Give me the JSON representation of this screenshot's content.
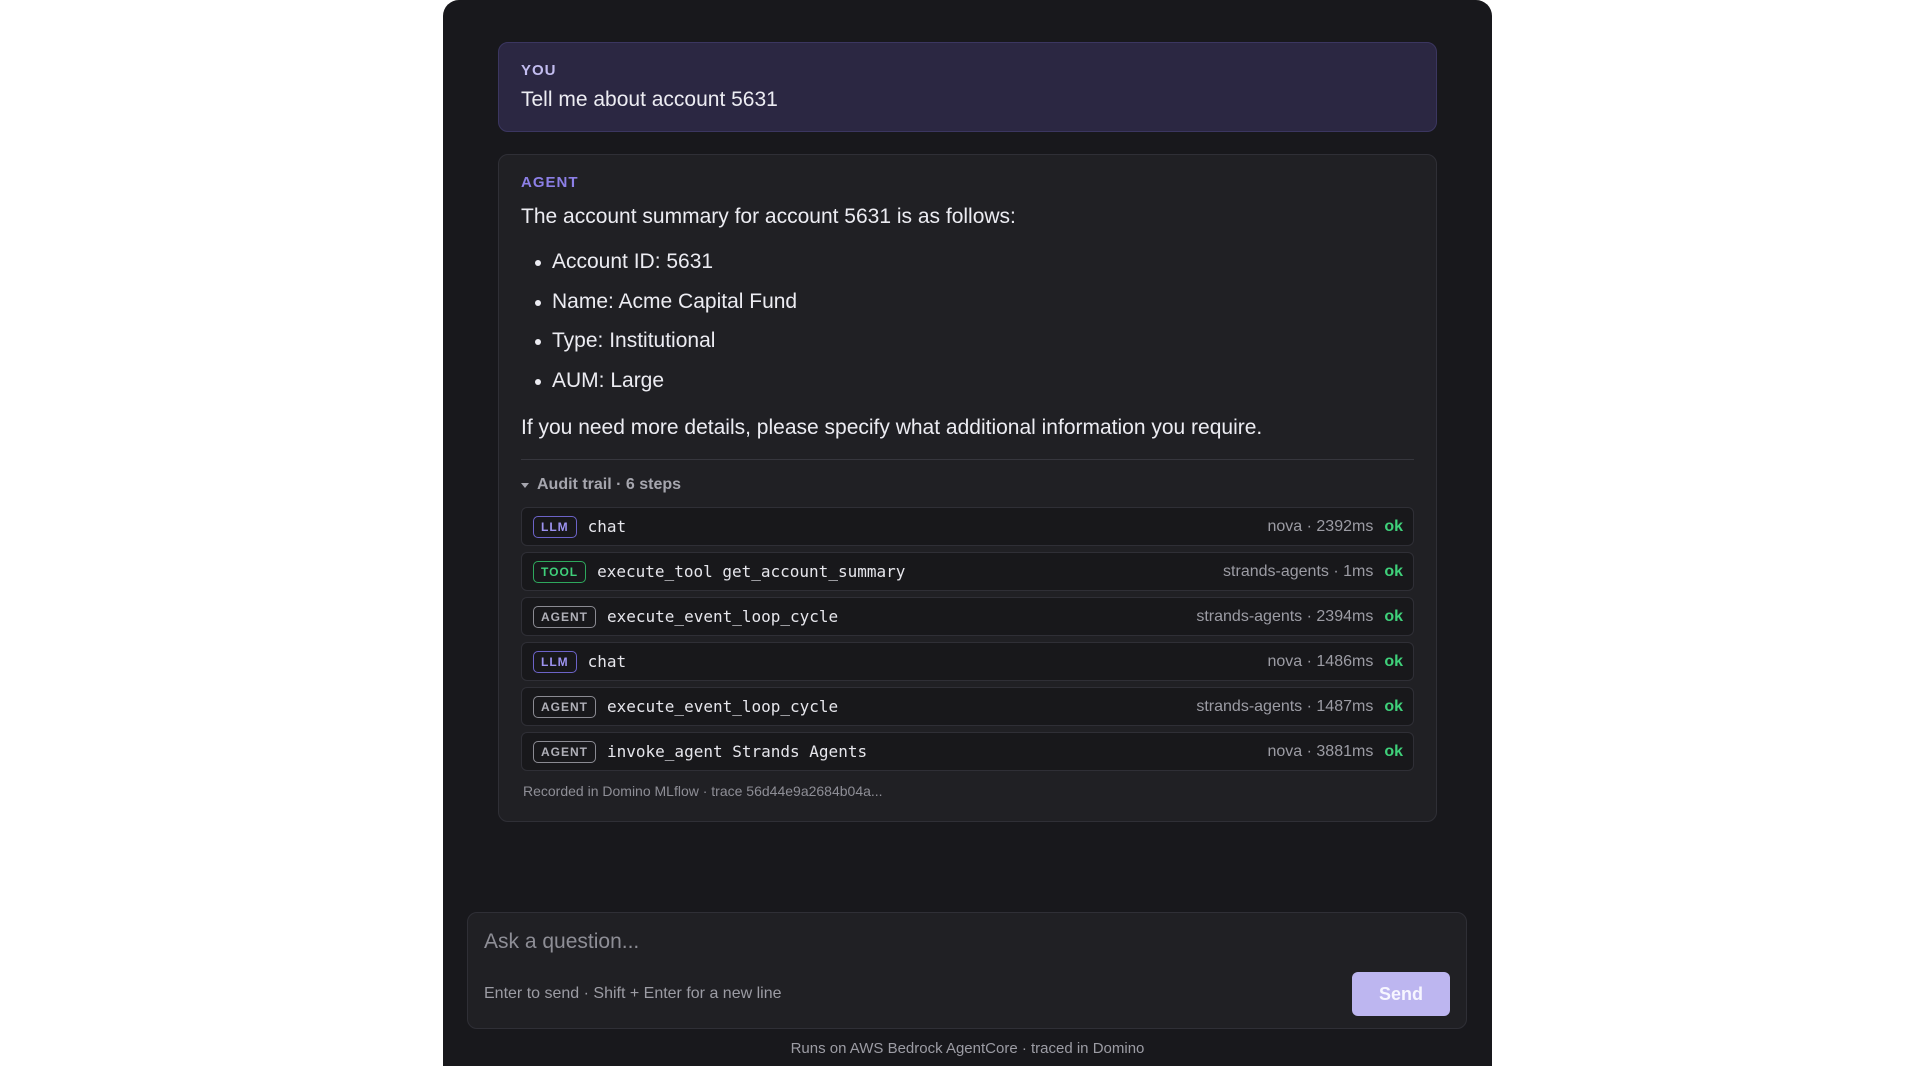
{
  "you_message": {
    "role": "YOU",
    "text": "Tell me about account 5631"
  },
  "agent_message": {
    "role": "AGENT",
    "intro": "The account summary for account 5631 is as follows:",
    "bullets": [
      "Account ID: 5631",
      "Name: Acme Capital Fund",
      "Type: Institutional",
      "AUM: Large"
    ],
    "outro": "If you need more details, please specify what additional information you require."
  },
  "audit": {
    "title": "Audit trail · 6 steps",
    "steps": [
      {
        "badge": "LLM",
        "name": "chat",
        "meta": "nova · 2392ms",
        "status": "ok"
      },
      {
        "badge": "TOOL",
        "name": "execute_tool get_account_summary",
        "meta": "strands-agents · 1ms",
        "status": "ok"
      },
      {
        "badge": "AGENT",
        "name": "execute_event_loop_cycle",
        "meta": "strands-agents · 2394ms",
        "status": "ok"
      },
      {
        "badge": "LLM",
        "name": "chat",
        "meta": "nova · 1486ms",
        "status": "ok"
      },
      {
        "badge": "AGENT",
        "name": "execute_event_loop_cycle",
        "meta": "strands-agents · 1487ms",
        "status": "ok"
      },
      {
        "badge": "AGENT",
        "name": "invoke_agent Strands Agents",
        "meta": "nova · 3881ms",
        "status": "ok"
      }
    ],
    "recorded": "Recorded in Domino MLflow · trace 56d44e9a2684b04a..."
  },
  "composer": {
    "placeholder": "Ask a question...",
    "hint": "Enter to send · Shift + Enter for a new line",
    "send_label": "Send"
  },
  "footer": "Runs on AWS Bedrock AgentCore · traced in Domino",
  "colors": {
    "background": "#18181c",
    "you_bubble": "#2b2742",
    "agent_accent": "#8c7fe6",
    "ok_status": "#3fd07a",
    "send_button": "#bdb6f0"
  }
}
